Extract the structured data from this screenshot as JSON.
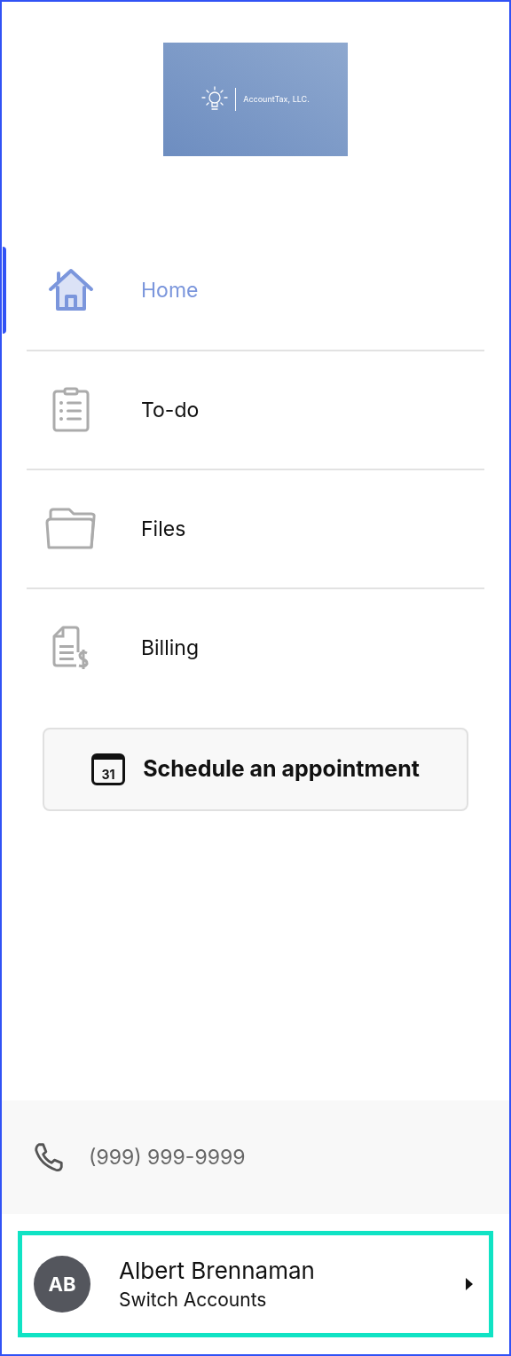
{
  "logo": {
    "company": "AccountTax, LLC."
  },
  "nav": [
    {
      "kind": "home",
      "label": "Home",
      "selected": true
    },
    {
      "kind": "todo",
      "label": "To-do",
      "selected": false
    },
    {
      "kind": "files",
      "label": "Files",
      "selected": false
    },
    {
      "kind": "billing",
      "label": "Billing",
      "selected": false
    }
  ],
  "schedule_button": {
    "label": "Schedule an appointment",
    "day": "31"
  },
  "phone": "(999) 999-9999",
  "account": {
    "initials": "AB",
    "name": "Albert Brennaman",
    "action": "Switch Accounts"
  }
}
